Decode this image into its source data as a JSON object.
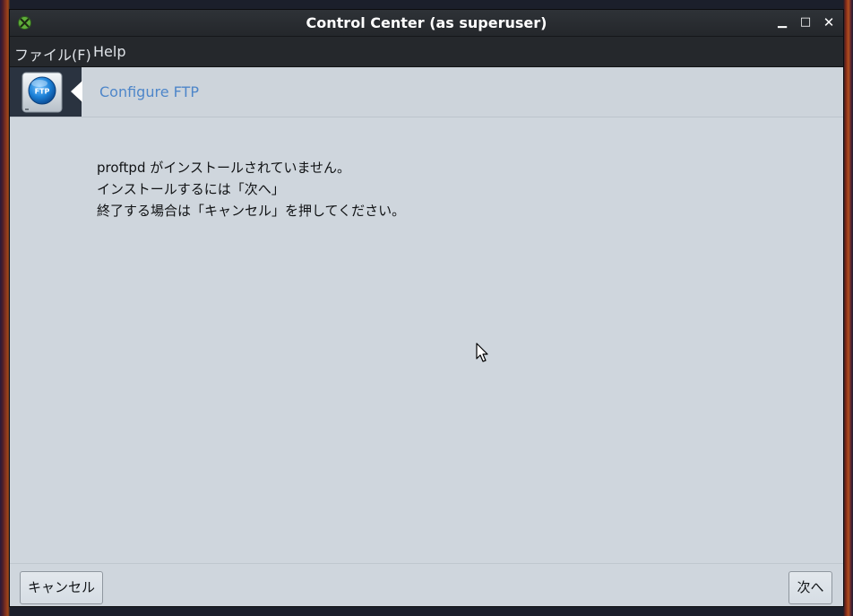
{
  "window": {
    "title": "Control Center (as superuser)",
    "controls": {
      "minimize": "▁",
      "maximize": "□",
      "close": "✕"
    }
  },
  "menubar": {
    "items": [
      "ファイル(F)",
      "Help"
    ]
  },
  "banner": {
    "title": "Configure FTP",
    "icon_label": "FTP",
    "icon": "ftp-icon"
  },
  "messages": [
    "proftpd がインストールされていません。",
    "インストールするには「次へ」",
    "終了する場合は「キャンセル」を押してください。"
  ],
  "buttons": {
    "cancel": "キャンセル",
    "next": "次へ"
  },
  "colors": {
    "accent": "#4e86c9",
    "content_bg": "#cfd6dd",
    "titlebar_bg": "#2e3237"
  }
}
